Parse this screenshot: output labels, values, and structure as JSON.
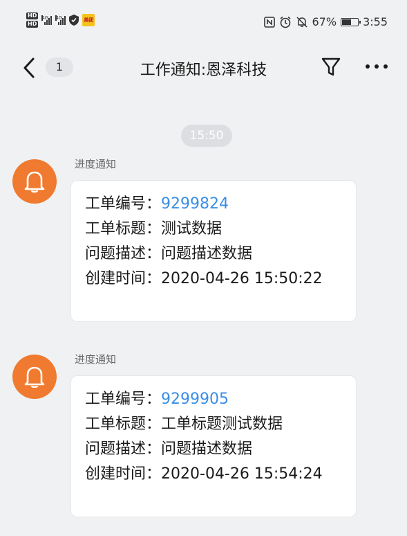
{
  "status_bar": {
    "hd_top": "HD",
    "hd_bottom": "HD",
    "net1": "4G",
    "net2": "4G",
    "app_badge": "美团",
    "battery_percent": "67%",
    "battery_level": 0.67,
    "time": "3:55"
  },
  "nav": {
    "unread_count": "1",
    "title": "工作通知:恩泽科技"
  },
  "timestamp_chip": "15:50",
  "messages": [
    {
      "sender": "进度通知",
      "rows": [
        {
          "label": "工单编号：",
          "value": "9299824"
        },
        {
          "label": "工单标题：",
          "value": "测试数据"
        },
        {
          "label": "问题描述：",
          "value": "问题描述数据"
        },
        {
          "label": "创建时间：",
          "value": "2020-04-26 15:50:22"
        }
      ]
    },
    {
      "sender": "进度通知",
      "rows": [
        {
          "label": "工单编号：",
          "value": "9299905"
        },
        {
          "label": "工单标题：",
          "value": "工单标题测试数据"
        },
        {
          "label": "问题描述：",
          "value": "问题描述数据"
        },
        {
          "label": "创建时间：",
          "value": "2020-04-26 15:54:24"
        }
      ]
    }
  ],
  "colors": {
    "accent_link": "#3a8ee6",
    "avatar": "#f07a2f",
    "background": "#f0f1f3"
  }
}
